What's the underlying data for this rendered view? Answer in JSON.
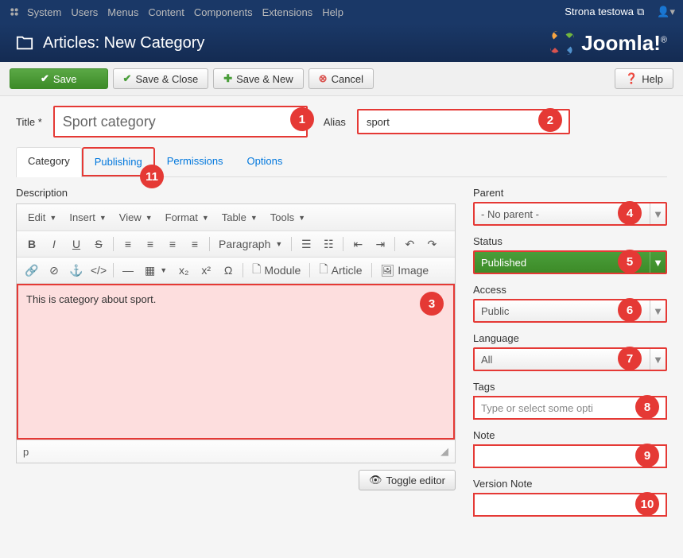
{
  "topbar": {
    "menu": [
      "System",
      "Users",
      "Menus",
      "Content",
      "Components",
      "Extensions",
      "Help"
    ],
    "site": "Strona testowa"
  },
  "header": {
    "title": "Articles: New Category",
    "logo": "Joomla!"
  },
  "toolbar": {
    "save": "Save",
    "saveClose": "Save & Close",
    "saveNew": "Save & New",
    "cancel": "Cancel",
    "help": "Help"
  },
  "fields": {
    "titleLabel": "Title *",
    "titleValue": "Sport category",
    "aliasLabel": "Alias",
    "aliasValue": "sport",
    "descLabel": "Description",
    "descContent": "This is category about sport.",
    "parentLabel": "Parent",
    "parentValue": "- No parent -",
    "statusLabel": "Status",
    "statusValue": "Published",
    "accessLabel": "Access",
    "accessValue": "Public",
    "languageLabel": "Language",
    "languageValue": "All",
    "tagsLabel": "Tags",
    "tagsPlaceholder": "Type or select some opti",
    "noteLabel": "Note",
    "versionLabel": "Version Note"
  },
  "tabs": [
    "Category",
    "Publishing",
    "Permissions",
    "Options"
  ],
  "editor": {
    "menus": [
      "Edit",
      "Insert",
      "View",
      "Format",
      "Table",
      "Tools"
    ],
    "paragraph": "Paragraph",
    "module": "Module",
    "article": "Article",
    "image": "Image",
    "status": "p",
    "toggle": "Toggle editor"
  },
  "annotations": {
    "1": "1",
    "2": "2",
    "3": "3",
    "4": "4",
    "5": "5",
    "6": "6",
    "7": "7",
    "8": "8",
    "9": "9",
    "10": "10",
    "11": "11"
  }
}
